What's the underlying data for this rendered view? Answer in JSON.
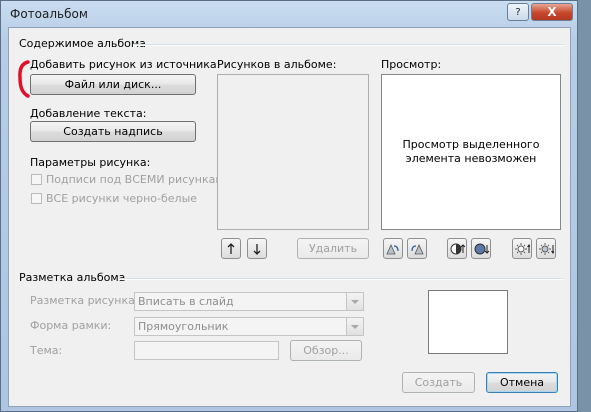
{
  "window": {
    "title": "Фотоальбом",
    "help_label": "?",
    "close_label": "X"
  },
  "album_content": {
    "group_label": "Содержимое альбома",
    "add_picture_label": "Добавить рисунок из источника:",
    "file_or_disk_button": "Файл или диск...",
    "add_text_label": "Добавление текста:",
    "new_text_box_button": "Создать надпись",
    "picture_options_label": "Параметры рисунка:",
    "captions_checkbox": "Подписи под ВСЕМИ рисунками",
    "bw_checkbox": "ВСЕ рисунки черно-белые",
    "pictures_in_album_label": "Рисунков в альбоме:",
    "remove_button": "Удалить",
    "preview_label": "Просмотр:",
    "preview_message_line1": "Просмотр выделенного",
    "preview_message_line2": "элемента невозможен"
  },
  "album_layout": {
    "group_label": "Разметка альбома",
    "picture_layout_label": "Разметка рисунка:",
    "picture_layout_value": "Вписать в слайд",
    "frame_shape_label": "Форма рамки:",
    "frame_shape_value": "Прямоугольник",
    "theme_label": "Тема:",
    "theme_value": "",
    "browse_button": "Обзор..."
  },
  "footer": {
    "create_button": "Создать",
    "cancel_button": "Отмена"
  },
  "icons": {
    "move_up": "arrow-up-icon",
    "move_down": "arrow-down-icon",
    "rotate_left": "rotate-left-icon",
    "rotate_right": "rotate-right-icon",
    "contrast_up": "contrast-up-icon",
    "contrast_down": "contrast-down-icon",
    "brightness_up": "brightness-up-icon",
    "brightness_down": "brightness-down-icon"
  },
  "colors": {
    "title_bar": "#b7cde6",
    "close_button": "#c7462c",
    "dialog_bg": "#f0f0f0",
    "annotation_mark": "#e0102a"
  }
}
